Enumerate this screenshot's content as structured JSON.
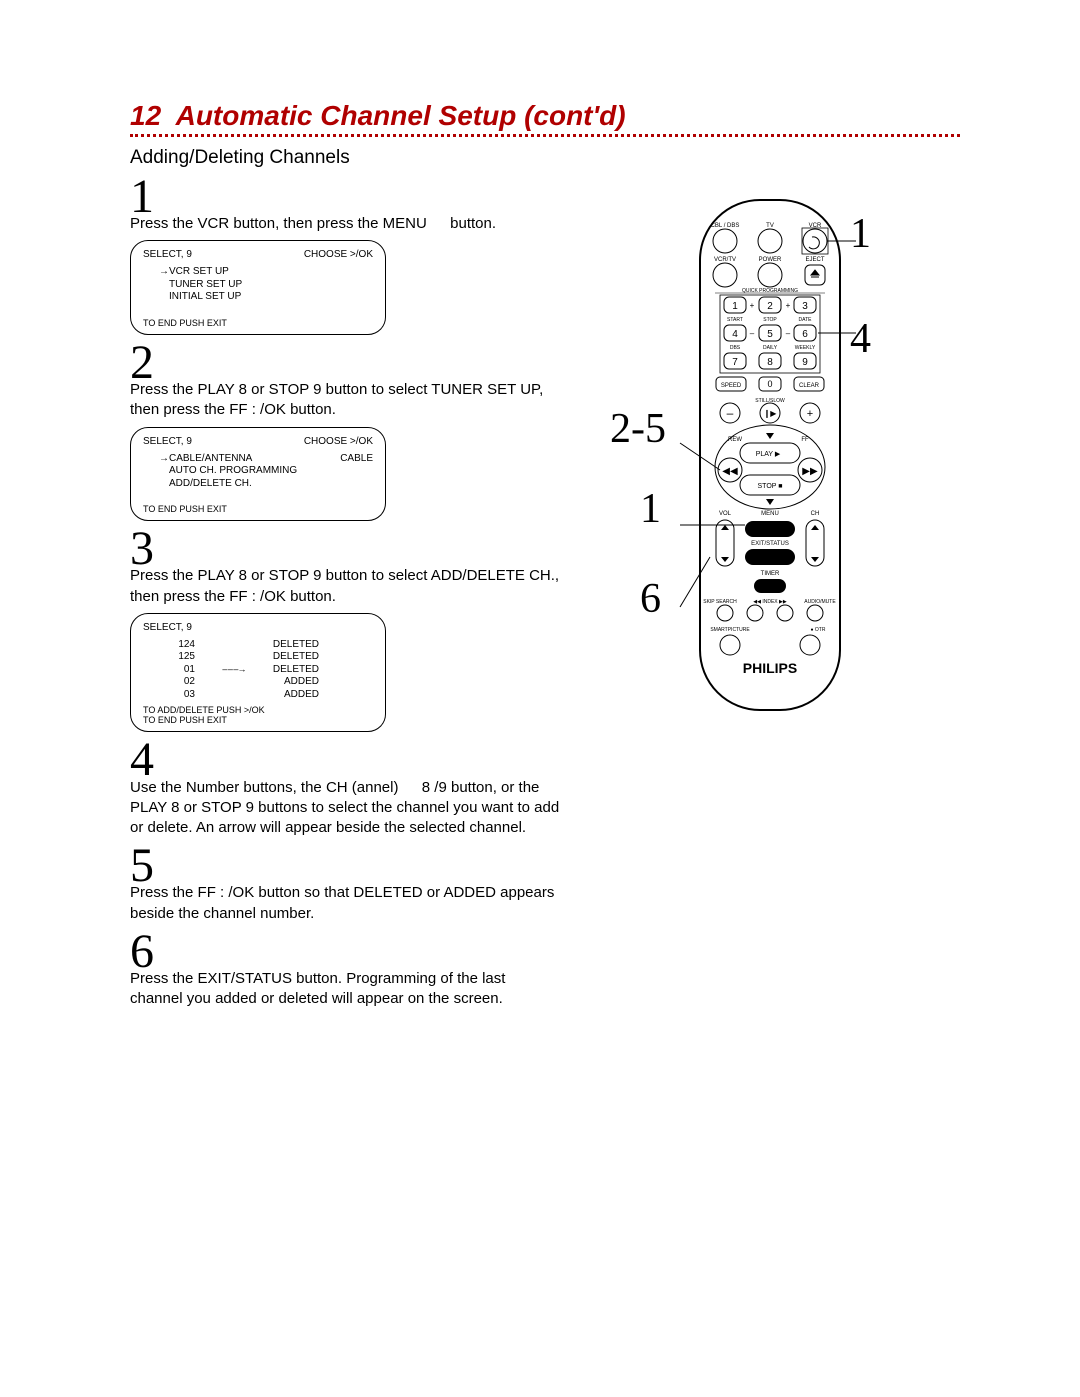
{
  "pageNumber": "12",
  "title": "Automatic Channel Setup (cont'd)",
  "subtitle": "Adding/Deleting Channels",
  "steps": {
    "s1": {
      "num": "1",
      "text": "Press the VCR button, then press the MENU   button."
    },
    "s2": {
      "num": "2",
      "text": "Press the PLAY 8  or STOP 9  button to select TUNER SET UP, then press the FF  :  /OK  button."
    },
    "s3": {
      "num": "3",
      "text": "Press the PLAY 8  or STOP 9  button to select ADD/DELETE   CH., then press the FF  :  /OK  button."
    },
    "s4": {
      "num": "4",
      "text": "Use the Number buttons, the CH (annel)   8 /9  button, or the PLAY 8  or STOP 9  buttons to select the channel you want to add or delete.   An arrow will appear beside the selected channel."
    },
    "s5": {
      "num": "5",
      "text": "Press the FF :  /OK button  so that  DELETED or ADDED appears beside the channel number."
    },
    "s6": {
      "num": "6",
      "text": "Press the EXIT/STATUS   button.  Programming of the last channel you added or deleted will appear on the screen."
    }
  },
  "osd1": {
    "selectLabel": "SELECT,  9",
    "chooseLabel": "CHOOSE >/OK",
    "item1": "VCR SET UP",
    "item2": "TUNER SET UP",
    "item3": "INITIAL SET UP",
    "footer": "TO END PUSH EXIT"
  },
  "osd2": {
    "selectLabel": "SELECT,  9",
    "chooseLabel": "CHOOSE >/OK",
    "line1a": "CABLE/ANTENNA",
    "line1b": "CABLE",
    "line2": "AUTO CH. PROGRAMMING",
    "line3": "ADD/DELETE CH.",
    "footer": "TO END PUSH EXIT"
  },
  "osd3": {
    "selectLabel": "SELECT,  9",
    "rows": [
      {
        "ch": "124",
        "st": "DELETED"
      },
      {
        "ch": "125",
        "st": "DELETED"
      },
      {
        "ch": "01",
        "st": "DELETED"
      },
      {
        "ch": "02",
        "st": "ADDED"
      },
      {
        "ch": "03",
        "st": "ADDED"
      }
    ],
    "footer1": "TO ADD/DELETE  PUSH >/OK",
    "footer2": "TO END PUSH EXIT"
  },
  "remote": {
    "brand": "PHILIPS",
    "labels": {
      "cbldbs": "CBL / DBS",
      "tv": "TV",
      "vcr": "VCR",
      "vcrtv": "VCR/TV",
      "power": "POWER",
      "eject": "EJECT",
      "quick": "QUICK PROGRAMMING",
      "start": "START",
      "stop": "STOP",
      "date": "DATE",
      "dbs": "DBS",
      "daily": "DAILY",
      "weekly": "WEEKLY",
      "speed": "SPEED",
      "zero": "0",
      "clear": "CLEAR",
      "stillslow": "STILL/SLOW",
      "rew": "REW",
      "play": "PLAY",
      "ff": "FF",
      "stopb": "STOP",
      "vol": "VOL",
      "menu": "MENU",
      "ch": "CH",
      "exitstatus": "EXIT/STATUS",
      "timer": "TIMER",
      "skipsearch": "SKIP SEARCH",
      "index": "INDEX",
      "audiomute": "AUDIO/MUTE",
      "smartpicture": "SMARTPICTURE",
      "otr": "OTR"
    },
    "nums": {
      "n1": "1",
      "n2": "2",
      "n3": "3",
      "n4": "4",
      "n5": "5",
      "n6": "6",
      "n7": "7",
      "n8": "8",
      "n9": "9"
    },
    "pm": {
      "plus": "+",
      "minus": "–"
    }
  },
  "callouts": {
    "c1": "1",
    "c25": "2-5",
    "c1b": "1",
    "c4": "4",
    "c6": "6"
  }
}
